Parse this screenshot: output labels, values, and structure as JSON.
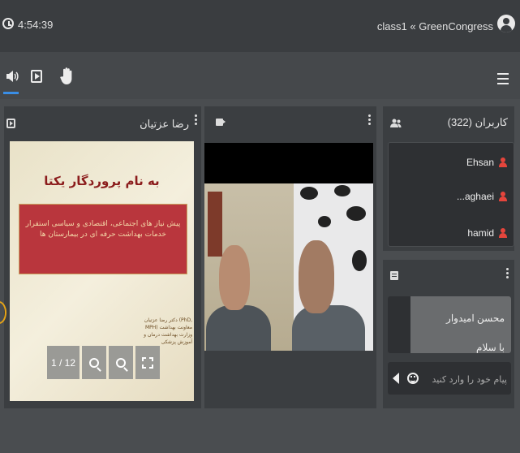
{
  "header": {
    "time": "4:54:39",
    "room_title": "class1 « GreenCongress"
  },
  "presentation": {
    "presenter": "رضا عزتیان",
    "slide_title": "به نام پروردگار یکتا",
    "slide_body": "پیش نیاز های اجتماعی، اقتصادی و سیاسی استقرار خدمات بهداشت حرفه ای در بیمارستان ها",
    "slide_footer": "دکتر رضا عزتیان (PhD, MPH) معاونت بهداشت وزارت بهداشت درمان و آموزش پزشکی",
    "page_indicator": "1 / 12"
  },
  "users": {
    "title": "کاربران (322)",
    "list": [
      {
        "name": "Ehsan"
      },
      {
        "name": "...aghaei"
      },
      {
        "name": "hamid"
      }
    ]
  },
  "chat": {
    "sender": "محسن امیدوار",
    "message": "با سلام",
    "input_placeholder": "پیام خود را وارد کنید"
  },
  "colors": {
    "accent": "#3a8ee6",
    "user_icon": "#e5453c",
    "slide_box": "#b9363d"
  }
}
